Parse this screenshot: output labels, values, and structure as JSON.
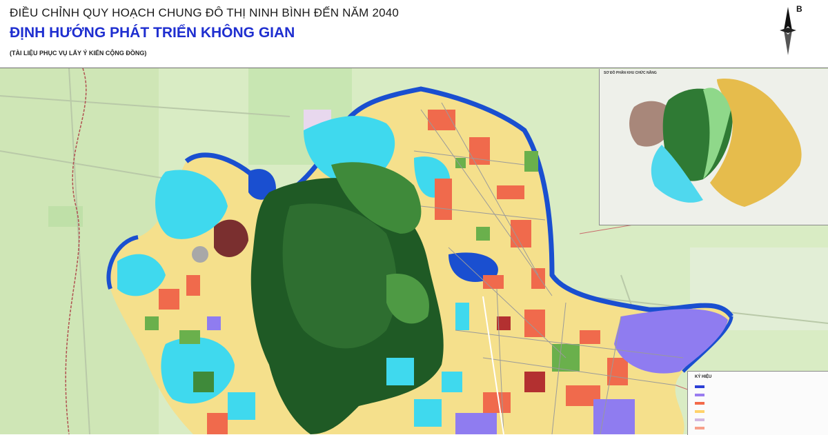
{
  "header": {
    "title": "ĐIỀU CHỈNH QUY HOẠCH CHUNG ĐÔ THỊ NINH BÌNH ĐẾN NĂM 2040",
    "subtitle": "ĐỊNH HƯỚNG PHÁT TRIỂN KHÔNG GIAN",
    "note": "(TÀI LIỆU PHỤC VỤ LẤY Ý KIẾN CỘNG ĐỒNG)",
    "north_label": "B"
  },
  "inset": {
    "title": "SƠ ĐỒ PHÂN KHU CHỨC NĂNG"
  },
  "legend": {
    "title": "KÝ HIỆU",
    "colors": [
      "#2c3fd6",
      "#9a7cf0",
      "#f36a4a",
      "#ffd36b",
      "#d2b7e0",
      "#f7a08a"
    ]
  },
  "colors": {
    "river": "#1a4fd0",
    "water": "#3fd9ee",
    "forest_dark": "#1f5a25",
    "forest": "#3f8a3a",
    "residential": "#f5e08c",
    "commercial": "#f06a4c",
    "industrial": "#8f7cf0",
    "park": "#6ab04c",
    "farmland": "#d9ecc4"
  }
}
